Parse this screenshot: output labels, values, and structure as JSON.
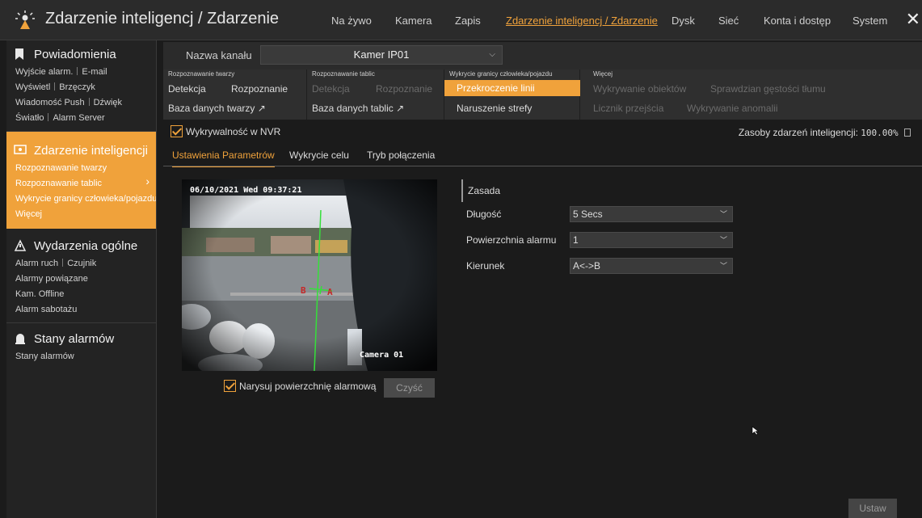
{
  "header": {
    "title": "Zdarzenie inteligencj / Zdarzenie",
    "nav": [
      {
        "label": "Na żywo",
        "active": false
      },
      {
        "label": "Kamera",
        "active": false
      },
      {
        "label": "Zapis",
        "active": false
      },
      {
        "label": "Zdarzenie inteligencj / Zdarzenie",
        "active": true
      },
      {
        "label": "Dysk",
        "active": false
      },
      {
        "label": "Sieć",
        "active": false
      },
      {
        "label": "Konta i dostęp",
        "active": false
      },
      {
        "label": "System",
        "active": false
      }
    ],
    "close_icon": "close-icon"
  },
  "sidebar": {
    "notifications": {
      "title": "Powiadomienia",
      "icon": "bookmark-icon",
      "rows": [
        [
          "Wyjście alarm.",
          "E-mail"
        ],
        [
          "Wyświetl",
          "Brzęczyk"
        ],
        [
          "Wiadomość Push",
          "Dźwięk"
        ],
        [
          "Światło",
          "Alarm Server"
        ]
      ]
    },
    "intelligent": {
      "title": "Zdarzenie inteligencji",
      "icon": "ai-event-icon",
      "items": [
        "Rozpoznawanie twarzy",
        "Rozpoznawanie tablic",
        "Wykrycie granicy człowieka/pojazdu",
        "Więcej"
      ]
    },
    "general": {
      "title": "Wydarzenia ogólne",
      "icon": "general-event-icon",
      "rows": [
        [
          "Alarm ruch",
          "Czujnik"
        ],
        [
          "Alarmy powiązane"
        ],
        [
          "Kam. Offline"
        ],
        [
          "Alarm sabotażu"
        ]
      ]
    },
    "alarm_states": {
      "title": "Stany alarmów",
      "icon": "alarm-state-icon",
      "items": [
        "Stany alarmów"
      ]
    }
  },
  "channel": {
    "label": "Nazwa kanału",
    "value": "Kamer IP01"
  },
  "feature_grid": {
    "face": {
      "caption": "Rozpoznawanie twarzy",
      "detect": "Detekcja",
      "recognize": "Rozpoznanie",
      "db": "Baza danych twarzy"
    },
    "plate": {
      "caption": "Rozpoznawanie tablic",
      "detect": "Detekcja",
      "recognize": "Rozpoznanie",
      "db": "Baza danych tablic"
    },
    "boundary": {
      "caption": "Wykrycie granicy człowieka/pojazdu",
      "line": "Przekroczenie linii",
      "zone": "Naruszenie strefy"
    },
    "more": {
      "caption": "Więcej",
      "items": [
        "Wykrywanie obiektów",
        "Sprawdzian gęstości tłumu",
        "Licznik przejścia",
        "Wykrywanie anomalii"
      ]
    }
  },
  "nvr": {
    "label": "Wykrywalność w NVR",
    "checked": true
  },
  "resources": {
    "label": "Zasoby zdarzeń inteligencji:",
    "value": "100.00%"
  },
  "tabs": [
    {
      "label": "Ustawienia Parametrów",
      "active": true
    },
    {
      "label": "Wykrycie celu",
      "active": false
    },
    {
      "label": "Tryb połączenia",
      "active": false
    }
  ],
  "video": {
    "timestamp": "06/10/2021 Wed 09:37:21",
    "camera_name": "Camera 01",
    "line_a": "A",
    "line_b": "B"
  },
  "draw_area": {
    "label": "Narysuj powierzchnię alarmową",
    "checked": true,
    "clear_label": "Czyść"
  },
  "form": {
    "section_title": "Zasada",
    "fields": [
      {
        "label": "Długość",
        "value": "5 Secs"
      },
      {
        "label": "Powierzchnia alarmu",
        "value": "1"
      },
      {
        "label": "Kierunek",
        "value": "A<->B"
      }
    ]
  },
  "apply_label": "Ustaw",
  "colors": {
    "accent": "#f0a23b",
    "background": "#1b1b1b",
    "panel": "#2b2b2b",
    "line": "#35e03a"
  }
}
